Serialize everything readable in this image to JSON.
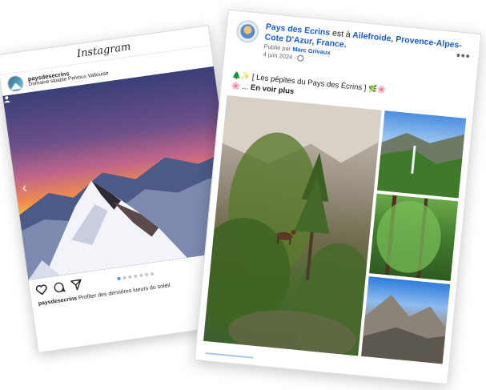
{
  "instagram": {
    "logo": "Instagram",
    "username": "paysdesecrins",
    "location": "Domaine skiable Pelvoux Vallouise",
    "carousel_count": 7,
    "carousel_active": 1,
    "caption_user": "paysdesecrins",
    "caption_text": "Profiter des dernières lueurs du soleil"
  },
  "facebook": {
    "page_name": "Pays des Ecrins",
    "at_text": "est à",
    "place": "Ailefroide, Provence-Alpes-Cote D'Azur, France.",
    "published_by_label": "Publié par",
    "author": "Marc Grivaux",
    "date": "4 juin 2024",
    "more_dots": "•••",
    "post_text": "[ Les pépites du Pays des Écrins ]",
    "ellipsis": "...",
    "see_more": "En voir plus"
  },
  "colors": {
    "fb_link": "#1a5ad6",
    "ig_dot_active": "#3897f0"
  }
}
